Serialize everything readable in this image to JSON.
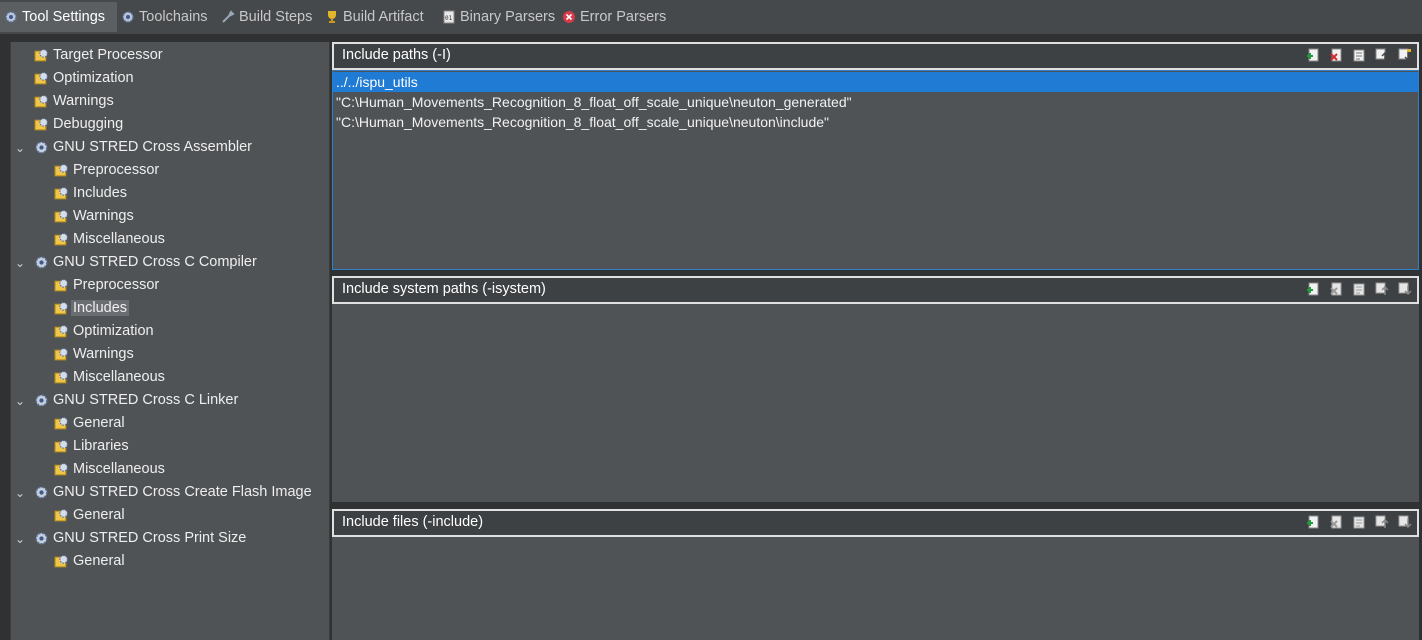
{
  "tabs": [
    {
      "label": "Tool Settings",
      "icon": "gear-icon",
      "active": true
    },
    {
      "label": "Toolchains",
      "icon": "gear-icon"
    },
    {
      "label": "Build Steps",
      "icon": "wrench-icon"
    },
    {
      "label": "Build Artifact",
      "icon": "trophy-icon"
    },
    {
      "label": "Binary Parsers",
      "icon": "binary-icon"
    },
    {
      "label": "Error Parsers",
      "icon": "error-icon"
    }
  ],
  "tree": [
    {
      "label": "Target Processor",
      "level": 1,
      "icon": "options-icon"
    },
    {
      "label": "Optimization",
      "level": 1,
      "icon": "options-icon"
    },
    {
      "label": "Warnings",
      "level": 1,
      "icon": "options-icon"
    },
    {
      "label": "Debugging",
      "level": 1,
      "icon": "options-icon"
    },
    {
      "label": "GNU STRED Cross Assembler",
      "level": 0,
      "icon": "tool-icon",
      "expanded": true
    },
    {
      "label": "Preprocessor",
      "level": 1,
      "icon": "options-icon"
    },
    {
      "label": "Includes",
      "level": 1,
      "icon": "options-icon"
    },
    {
      "label": "Warnings",
      "level": 1,
      "icon": "options-icon"
    },
    {
      "label": "Miscellaneous",
      "level": 1,
      "icon": "options-icon"
    },
    {
      "label": "GNU STRED Cross C Compiler",
      "level": 0,
      "icon": "tool-icon",
      "expanded": true
    },
    {
      "label": "Preprocessor",
      "level": 1,
      "icon": "options-icon"
    },
    {
      "label": "Includes",
      "level": 1,
      "icon": "options-icon",
      "selected": true
    },
    {
      "label": "Optimization",
      "level": 1,
      "icon": "options-icon"
    },
    {
      "label": "Warnings",
      "level": 1,
      "icon": "options-icon"
    },
    {
      "label": "Miscellaneous",
      "level": 1,
      "icon": "options-icon"
    },
    {
      "label": "GNU STRED Cross C Linker",
      "level": 0,
      "icon": "tool-icon",
      "expanded": true
    },
    {
      "label": "General",
      "level": 1,
      "icon": "options-icon"
    },
    {
      "label": "Libraries",
      "level": 1,
      "icon": "options-icon"
    },
    {
      "label": "Miscellaneous",
      "level": 1,
      "icon": "options-icon"
    },
    {
      "label": "GNU STRED Cross Create Flash Image",
      "level": 0,
      "icon": "tool-icon",
      "expanded": true
    },
    {
      "label": "General",
      "level": 1,
      "icon": "options-icon"
    },
    {
      "label": "GNU STRED Cross Print Size",
      "level": 0,
      "icon": "tool-icon",
      "expanded": true
    },
    {
      "label": "General",
      "level": 1,
      "icon": "options-icon"
    }
  ],
  "sections": [
    {
      "title": "Include paths (-I)",
      "tools": [
        "add-icon",
        "delete-icon",
        "edit-icon",
        "move-up-icon",
        "move-down-icon"
      ],
      "items": [
        "../../ispu_utils",
        "\"C:\\Human_Movements_Recognition_8_float_off_scale_unique\\neuton_generated\"",
        "\"C:\\Human_Movements_Recognition_8_float_off_scale_unique\\neuton\\include\""
      ],
      "selected_index": 0
    },
    {
      "title": "Include system paths (-isystem)",
      "tools": [
        "add-icon",
        "delete-icon",
        "edit-icon",
        "move-up-icon",
        "move-down-icon"
      ],
      "items": []
    },
    {
      "title": "Include files (-include)",
      "tools": [
        "add-icon",
        "delete-icon",
        "edit-icon",
        "move-up-icon",
        "move-down-icon"
      ],
      "items": []
    }
  ]
}
